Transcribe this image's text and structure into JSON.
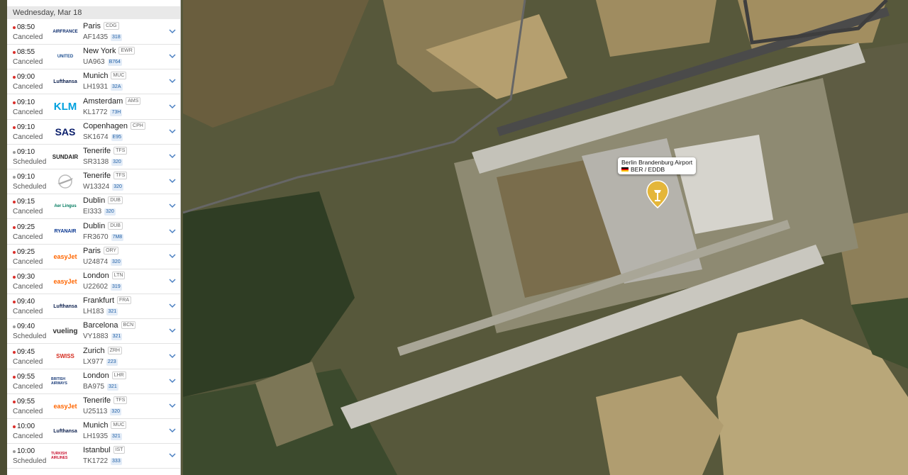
{
  "colors": {
    "canceled": "#d9302c",
    "scheduled": "#9a9a9a",
    "aircraft_badge": "#1f5fa6",
    "pin": "#e4b63a"
  },
  "date_header": "Wednesday, Mar 18",
  "flights": [
    {
      "time": "08:50",
      "status": "Canceled",
      "airline": "AIRFRANCE",
      "city": "Paris",
      "iata": "CDG",
      "flight": "AF1435",
      "aircraft": "318"
    },
    {
      "time": "08:55",
      "status": "Canceled",
      "airline": "UNITED",
      "city": "New York",
      "iata": "EWR",
      "flight": "UA963",
      "aircraft": "B764"
    },
    {
      "time": "09:00",
      "status": "Canceled",
      "airline": "Lufthansa",
      "city": "Munich",
      "iata": "MUC",
      "flight": "LH1931",
      "aircraft": "32A"
    },
    {
      "time": "09:10",
      "status": "Canceled",
      "airline": "KLM",
      "city": "Amsterdam",
      "iata": "AMS",
      "flight": "KL1772",
      "aircraft": "73H"
    },
    {
      "time": "09:10",
      "status": "Canceled",
      "airline": "SAS",
      "city": "Copenhagen",
      "iata": "CPH",
      "flight": "SK1674",
      "aircraft": "E95"
    },
    {
      "time": "09:10",
      "status": "Scheduled",
      "airline": "SUNDAIR",
      "city": "Tenerife",
      "iata": "TFS",
      "flight": "SR3138",
      "aircraft": "320"
    },
    {
      "time": "09:10",
      "status": "Scheduled",
      "airline": "",
      "city": "Tenerife",
      "iata": "TFS",
      "flight": "W13324",
      "aircraft": "320"
    },
    {
      "time": "09:15",
      "status": "Canceled",
      "airline": "Aer Lingus",
      "city": "Dublin",
      "iata": "DUB",
      "flight": "EI333",
      "aircraft": "320"
    },
    {
      "time": "09:25",
      "status": "Canceled",
      "airline": "RYANAIR",
      "city": "Dublin",
      "iata": "DUB",
      "flight": "FR3670",
      "aircraft": "7M8"
    },
    {
      "time": "09:25",
      "status": "Canceled",
      "airline": "easyJet",
      "city": "Paris",
      "iata": "ORY",
      "flight": "U24874",
      "aircraft": "320"
    },
    {
      "time": "09:30",
      "status": "Canceled",
      "airline": "easyJet",
      "city": "London",
      "iata": "LTN",
      "flight": "U22602",
      "aircraft": "319"
    },
    {
      "time": "09:40",
      "status": "Canceled",
      "airline": "Lufthansa",
      "city": "Frankfurt",
      "iata": "FRA",
      "flight": "LH183",
      "aircraft": "321"
    },
    {
      "time": "09:40",
      "status": "Scheduled",
      "airline": "vueling",
      "city": "Barcelona",
      "iata": "BCN",
      "flight": "VY1883",
      "aircraft": "321"
    },
    {
      "time": "09:45",
      "status": "Canceled",
      "airline": "SWISS",
      "city": "Zurich",
      "iata": "ZRH",
      "flight": "LX977",
      "aircraft": "223"
    },
    {
      "time": "09:55",
      "status": "Canceled",
      "airline": "BRITISH AIRWAYS",
      "city": "London",
      "iata": "LHR",
      "flight": "BA975",
      "aircraft": "321"
    },
    {
      "time": "09:55",
      "status": "Canceled",
      "airline": "easyJet",
      "city": "Tenerife",
      "iata": "TFS",
      "flight": "U25113",
      "aircraft": "320"
    },
    {
      "time": "10:00",
      "status": "Canceled",
      "airline": "Lufthansa",
      "city": "Munich",
      "iata": "MUC",
      "flight": "LH1935",
      "aircraft": "321"
    },
    {
      "time": "10:00",
      "status": "Scheduled",
      "airline": "TURKISH AIRLINES",
      "city": "Istanbul",
      "iata": "IST",
      "flight": "TK1722",
      "aircraft": "333"
    }
  ],
  "airport": {
    "name": "Berlin Brandenburg Airport",
    "codes": "BER / EDDB"
  }
}
